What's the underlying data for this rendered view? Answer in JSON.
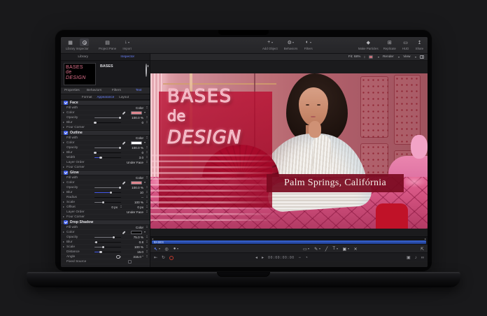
{
  "toolbar": {
    "left": [
      "Library",
      "Inspector",
      "Project Pane",
      "Import"
    ],
    "center": [
      "Add Object",
      "Behaviors",
      "Filters"
    ],
    "right": [
      "Make Particles",
      "Replicate",
      "HUD",
      "Share"
    ]
  },
  "inspector": {
    "pane_tabs": [
      "Library",
      "Inspector"
    ],
    "object": {
      "name": "BASES",
      "thumb_lines": [
        "BASES",
        "de",
        "DESIGN"
      ]
    },
    "tabs": [
      "Properties",
      "Behaviors",
      "Filters",
      "Text"
    ],
    "subtabs": [
      "Format",
      "Appearance",
      "Layout"
    ],
    "sections": [
      {
        "name": "Face",
        "rows": [
          {
            "label": "Fill with",
            "value": "Color"
          },
          {
            "label": "Color"
          },
          {
            "label": "Opacity",
            "value": "100.0 %"
          },
          {
            "label": "Blur",
            "value": "0"
          },
          {
            "label": "Four Corner"
          }
        ]
      },
      {
        "name": "Outline",
        "rows": [
          {
            "label": "Fill with",
            "value": "Color"
          },
          {
            "label": "Color"
          },
          {
            "label": "Opacity",
            "value": "100.0 %"
          },
          {
            "label": "Blur",
            "value": "0"
          },
          {
            "label": "Width",
            "value": "3.0"
          },
          {
            "label": "Layer Order",
            "value": "Under Face"
          },
          {
            "label": "Four Corner"
          }
        ]
      },
      {
        "name": "Glow",
        "rows": [
          {
            "label": "Fill with",
            "value": "Color"
          },
          {
            "label": "Color"
          },
          {
            "label": "Opacity",
            "value": "100.0 %"
          },
          {
            "label": "Blur",
            "value": "10"
          },
          {
            "label": "Radius",
            "value": "--"
          },
          {
            "label": "Scale",
            "value": "100 %"
          },
          {
            "label": "Offset",
            "x": "0 px",
            "y": "0 px"
          },
          {
            "label": "Layer Order",
            "value": "Under Face"
          },
          {
            "label": "Four Corner"
          }
        ]
      },
      {
        "name": "Drop Shadow",
        "rows": [
          {
            "label": "Fill with",
            "value": "Color"
          },
          {
            "label": "Color"
          },
          {
            "label": "Opacity",
            "value": "75.0 %"
          },
          {
            "label": "Blur",
            "value": "0.8"
          },
          {
            "label": "Scale",
            "value": "100 %"
          },
          {
            "label": "Distance",
            "value": "15.0"
          },
          {
            "label": "Angle",
            "value": "315.0 °"
          },
          {
            "label": "Fixed Source"
          }
        ]
      }
    ]
  },
  "canvas": {
    "fit": "Fit: 68%",
    "render": "Render",
    "view": "View",
    "title_lines": [
      "BASES",
      "de",
      "DESIGN"
    ],
    "location": "Palm Springs, Califórnia"
  },
  "timeline": {
    "clip_label": "BASES",
    "timecode": "00:00:00:00"
  },
  "colors": {
    "accent_blue": "#6b83ff",
    "face_swatch": "#e0868e",
    "outline_swatch": "#ffffff",
    "glow_swatch": "#e0868e",
    "shadow_swatch": "#0a0a0a",
    "overlay_red": "#b00a2a",
    "banner_red": "#7a0a20"
  }
}
